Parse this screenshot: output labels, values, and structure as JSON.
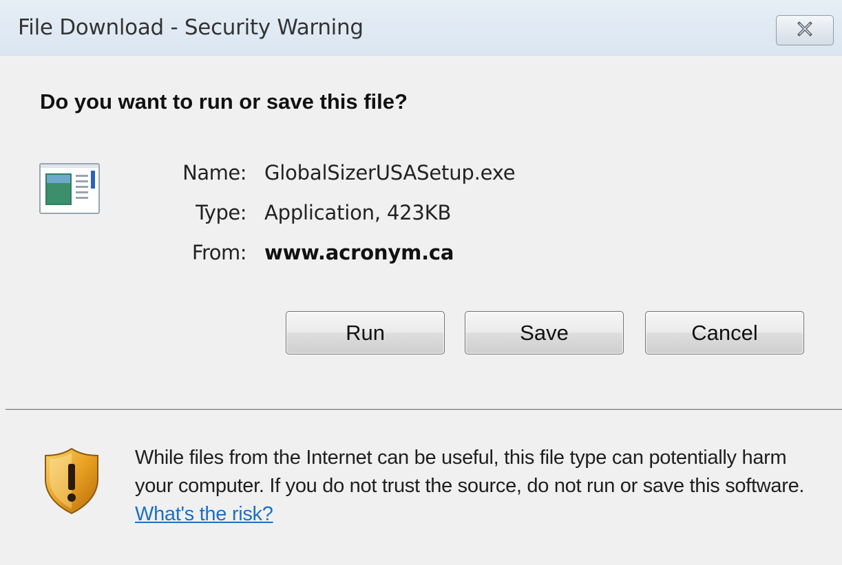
{
  "window": {
    "title": "File Download - Security Warning",
    "close_icon": "close-x-icon"
  },
  "prompt": {
    "question": "Do you want to run or save this file?"
  },
  "file": {
    "icon": "application-window-icon",
    "name_label": "Name:",
    "name_value": "GlobalSizerUSASetup.exe",
    "type_label": "Type:",
    "type_value": "Application, 423KB",
    "from_label": "From:",
    "from_value": "www.acronym.ca"
  },
  "buttons": {
    "run": "Run",
    "save": "Save",
    "cancel": "Cancel"
  },
  "warning": {
    "icon": "shield-warning-icon",
    "text": "While files from the Internet can be useful, this file type can potentially harm your computer. If you do not trust the source, do not run or save this software.",
    "link": "What's the risk?",
    "link_color": "#1a6fc9",
    "shield_color": "#e8a020"
  }
}
